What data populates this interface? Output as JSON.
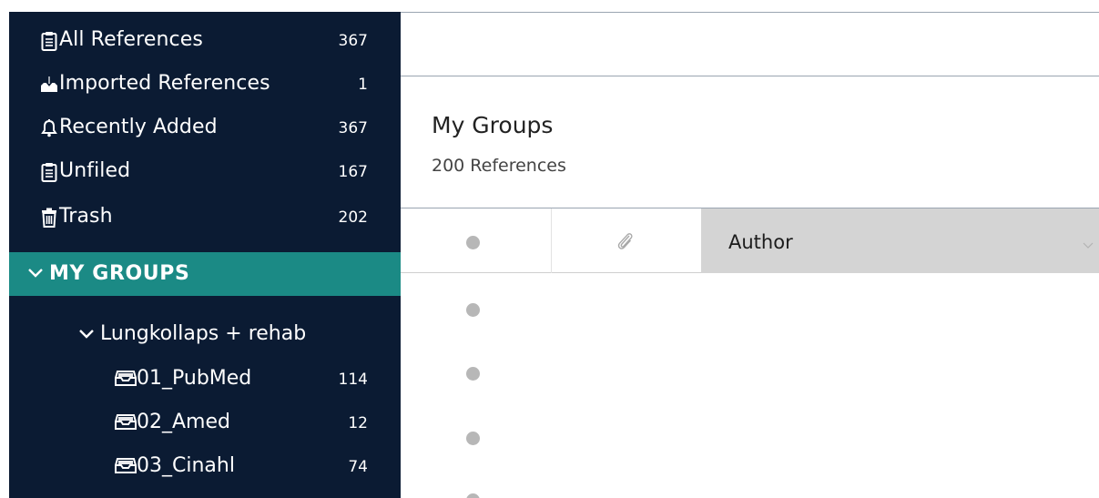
{
  "sidebar": {
    "items": [
      {
        "label": "All References",
        "count": "367",
        "icon": "clipboard-icon"
      },
      {
        "label": "Imported References",
        "count": "1",
        "icon": "import-icon"
      },
      {
        "label": "Recently Added",
        "count": "367",
        "icon": "bell-icon"
      },
      {
        "label": "Unfiled",
        "count": "167",
        "icon": "clipboard-icon"
      },
      {
        "label": "Trash",
        "count": "202",
        "icon": "trash-icon"
      }
    ],
    "groups_header": "MY GROUPS",
    "subgroup": {
      "label": "Lungkollaps + rehab"
    },
    "groups": [
      {
        "label": "01_PubMed",
        "count": "114",
        "icon": "inbox-icon"
      },
      {
        "label": "02_Amed",
        "count": "12",
        "icon": "inbox-icon"
      },
      {
        "label": "03_Cinahl",
        "count": "74",
        "icon": "inbox-icon"
      }
    ]
  },
  "main": {
    "title": "My Groups",
    "subtitle": "200 References",
    "table": {
      "columns": [
        {
          "label": "",
          "icon": "read-status-dot-icon"
        },
        {
          "label": "",
          "icon": "paperclip-icon"
        },
        {
          "label": "Author",
          "icon": "chevron-down-icon"
        }
      ],
      "rows_visible": 4
    }
  },
  "colors": {
    "sidebar_bg": "#0b1b33",
    "groups_header_bg": "#1b8a85",
    "author_header_bg": "#d4d4d4",
    "dot": "#b7b7b7"
  }
}
